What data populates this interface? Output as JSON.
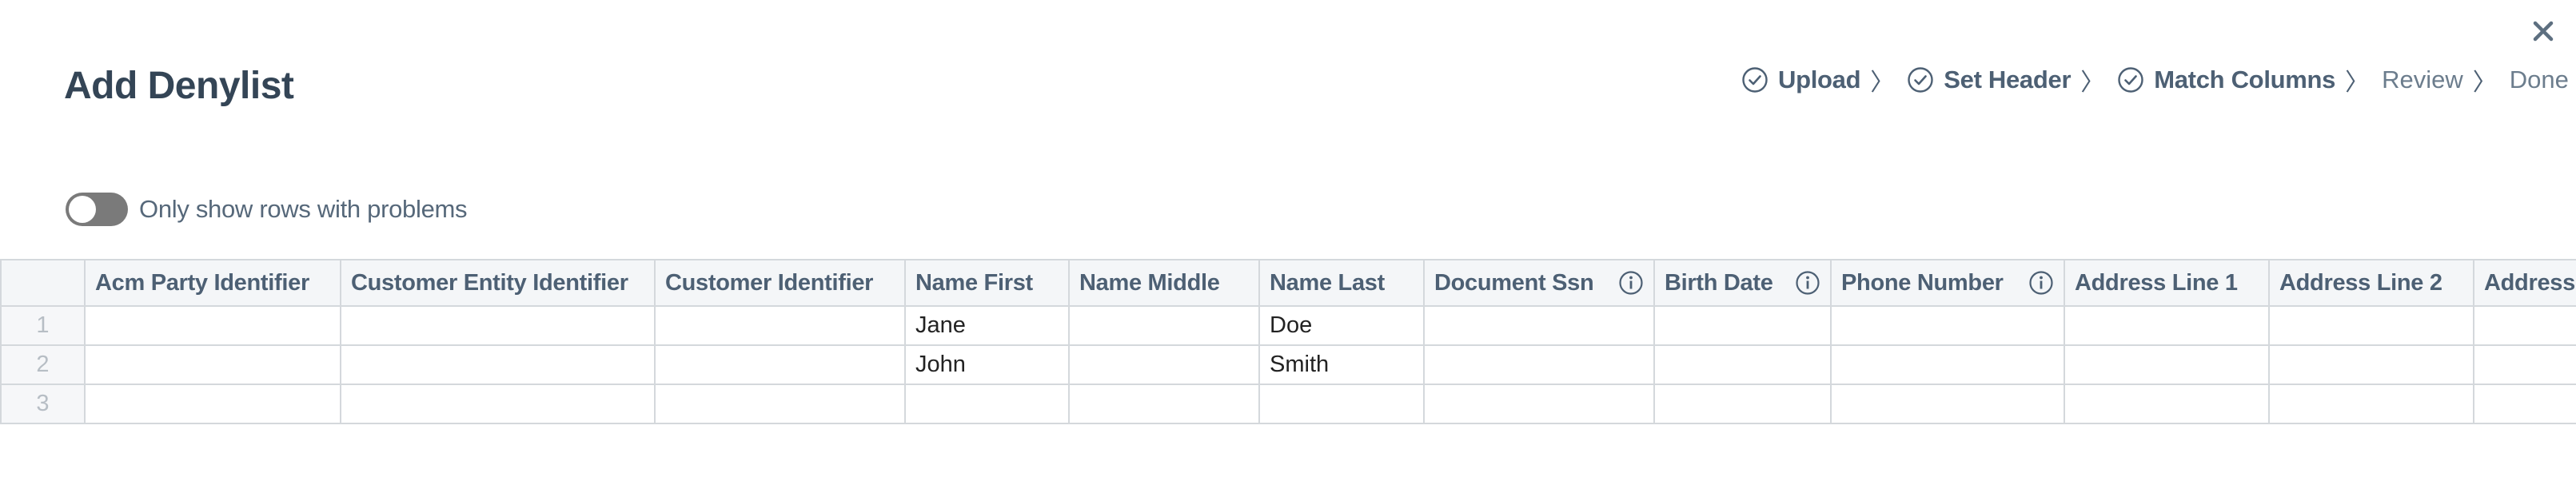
{
  "dialog": {
    "title": "Add Denylist",
    "close_icon": "close-icon"
  },
  "stepper": {
    "steps": [
      {
        "label": "Upload",
        "status": "done"
      },
      {
        "label": "Set Header",
        "status": "done"
      },
      {
        "label": "Match Columns",
        "status": "done"
      },
      {
        "label": "Review",
        "status": "pending"
      },
      {
        "label": "Done",
        "status": "pending"
      }
    ],
    "separator": "〉"
  },
  "filter": {
    "toggle_label": "Only show rows with problems",
    "toggle_on": false
  },
  "table": {
    "columns": [
      {
        "label": "Acm Party Identifier",
        "info": false
      },
      {
        "label": "Customer Entity Identifier",
        "info": false
      },
      {
        "label": "Customer Identifier",
        "info": false
      },
      {
        "label": "Name First",
        "info": false
      },
      {
        "label": "Name Middle",
        "info": false
      },
      {
        "label": "Name Last",
        "info": false
      },
      {
        "label": "Document Ssn",
        "info": true
      },
      {
        "label": "Birth Date",
        "info": true
      },
      {
        "label": "Phone Number",
        "info": true
      },
      {
        "label": "Address Line 1",
        "info": false
      },
      {
        "label": "Address Line 2",
        "info": false
      },
      {
        "label": "Address",
        "info": false
      }
    ],
    "rows": [
      {
        "index": "1",
        "cells": [
          "",
          "",
          "",
          "Jane",
          "",
          "Doe",
          "",
          "",
          "",
          "",
          "",
          ""
        ]
      },
      {
        "index": "2",
        "cells": [
          "",
          "",
          "",
          "John",
          "",
          "Smith",
          "",
          "",
          "",
          "",
          "",
          ""
        ]
      },
      {
        "index": "3",
        "cells": [
          "",
          "",
          "",
          "",
          "",
          "",
          "",
          "",
          "",
          "",
          "",
          ""
        ]
      }
    ]
  },
  "colors": {
    "text_primary": "#344556",
    "text_secondary": "#56687a",
    "grid_border": "#d4d8dc",
    "header_bg": "#f4f6f8",
    "toggle_off": "#7a7a7a"
  }
}
